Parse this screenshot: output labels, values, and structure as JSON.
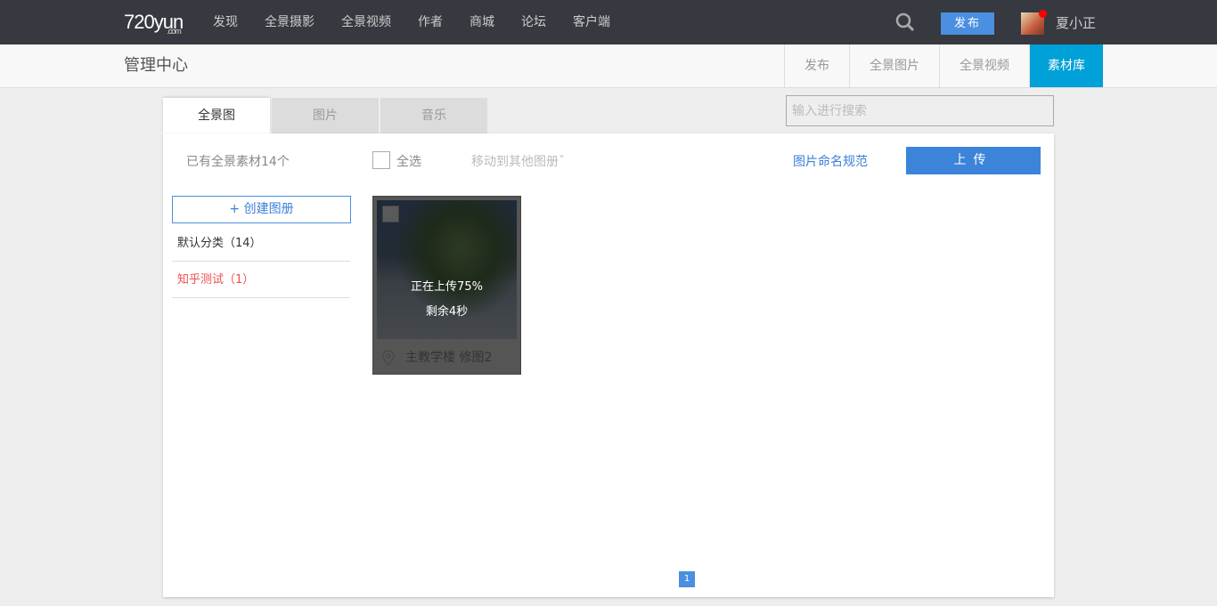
{
  "header": {
    "logo": "720yun",
    "logo_sub": ".com",
    "nav": [
      "发现",
      "全景摄影",
      "全景视频",
      "作者",
      "商城",
      "论坛",
      "客户端"
    ],
    "publish": "发布",
    "username": "夏小正"
  },
  "subheader": {
    "title": "管理中心",
    "tabs": [
      "发布",
      "全景图片",
      "全景视频",
      "素材库"
    ],
    "active_tab": "素材库"
  },
  "tabs": [
    "全景图",
    "图片",
    "音乐"
  ],
  "search": {
    "placeholder": "输入进行搜索",
    "value": ""
  },
  "toolbar": {
    "count": "已有全景素材14个",
    "select_all": "全选",
    "move": "移动到其他图册",
    "move_arrow": "ˇ",
    "naming_rule": "图片命名规范",
    "upload": "上传"
  },
  "sidebar": {
    "create": "+ 创建图册",
    "categories": [
      {
        "label": "默认分类（14）"
      },
      {
        "label": "知乎测试（1）"
      }
    ]
  },
  "card": {
    "progress": "正在上传75%",
    "remaining": "剩余4秒",
    "title": "主教学楼 修图2",
    "progress_percent": 75
  },
  "pagination": {
    "current": "1"
  },
  "colors": {
    "accent": "#00a0d8",
    "primary": "#3b84d9",
    "active_category": "#f05050"
  }
}
